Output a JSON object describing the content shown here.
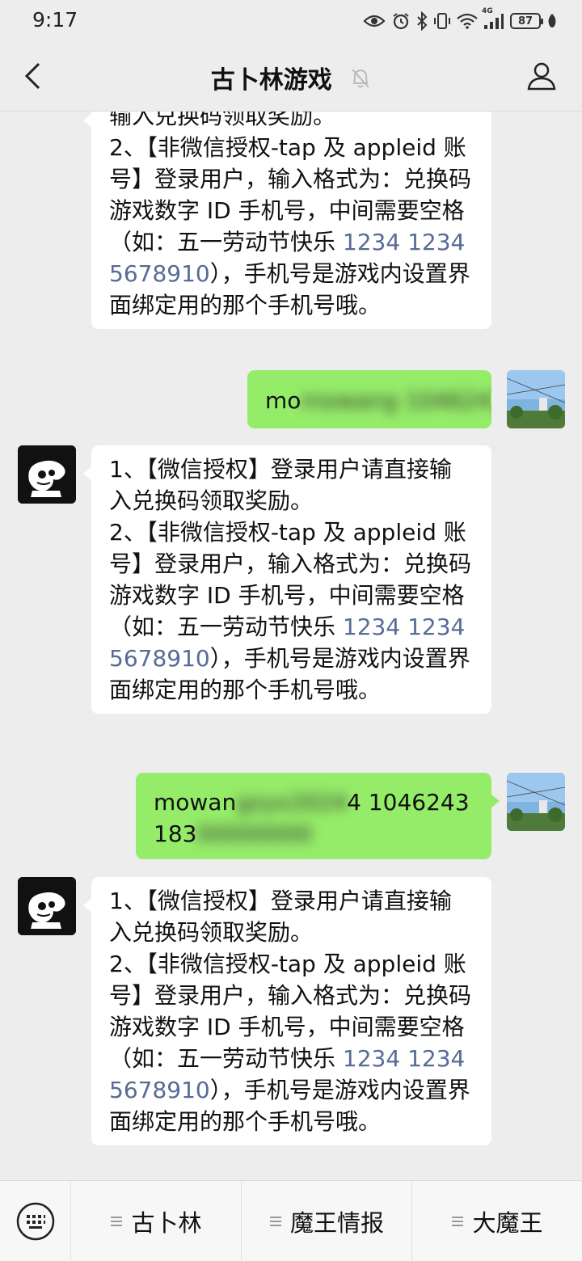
{
  "status_bar": {
    "time": "9:17",
    "battery": "87",
    "signal_label": "4G"
  },
  "header": {
    "title": "古卜林游戏"
  },
  "messages": {
    "m0": {
      "sender": "bot",
      "top_fragment": "输入兑换码领取奖励。",
      "line2a": "2、【非微信授权-tap 及 appleid 账号】登录用户，输入格式为：兑换码 游戏数字 ID 手机号，中间需要空格（如：五一劳动节快乐 ",
      "link": "1234 12345678910",
      "line2b": "），手机号是游戏内设置界面绑定用的那个手机号哦。"
    },
    "m1": {
      "sender": "me",
      "text": "mowang 1046243"
    },
    "m2": {
      "sender": "bot",
      "line1": "1、【微信授权】登录用户请直接输入兑换码领取奖励。",
      "line2a": "2、【非微信授权-tap 及 appleid 账号】登录用户，输入格式为：兑换码 游戏数字 ID 手机号，中间需要空格（如：五一劳动节快乐 ",
      "link": "1234 12345678910",
      "line2b": "），手机号是游戏内设置界面绑定用的那个手机号哦。"
    },
    "m3": {
      "sender": "me",
      "text_visible_a": "mowan",
      "text_hidden_a": "gzyx2024",
      "text_visible_b": "4 1046243",
      "text_visible_c": "183",
      "text_hidden_c": "00000000"
    },
    "m4": {
      "sender": "bot",
      "line1": "1、【微信授权】登录用户请直接输入兑换码领取奖励。",
      "line2a": "2、【非微信授权-tap 及 appleid 账号】登录用户，输入格式为：兑换码 游戏数字 ID 手机号，中间需要空格（如：五一劳动节快乐 ",
      "link": "1234 12345678910",
      "line2b": "），手机号是游戏内设置界面绑定用的那个手机号哦。"
    }
  },
  "menu": {
    "items": [
      {
        "label": "古卜林"
      },
      {
        "label": "魔王情报"
      },
      {
        "label": "大魔王"
      }
    ]
  },
  "colors": {
    "background": "#ededed",
    "bubble_out": "#95ec69",
    "bubble_in": "#ffffff",
    "link": "#576b95"
  }
}
